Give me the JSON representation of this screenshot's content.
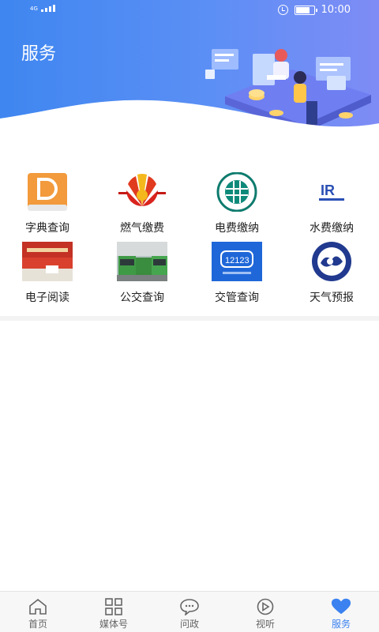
{
  "status_bar": {
    "network": "4G",
    "time": "10:00",
    "battery_level": 0.72
  },
  "header": {
    "title": "服务"
  },
  "services": [
    {
      "label": "字典查询",
      "icon": "dictionary-icon"
    },
    {
      "label": "燃气缴费",
      "icon": "petrochina-gas-icon"
    },
    {
      "label": "电费缴纳",
      "icon": "state-grid-icon"
    },
    {
      "label": "水费缴纳",
      "icon": "water-company-icon"
    },
    {
      "label": "电子阅读",
      "icon": "library-icon"
    },
    {
      "label": "公交查询",
      "icon": "bus-icon"
    },
    {
      "label": "交管查询",
      "icon": "traffic-12123-icon"
    },
    {
      "label": "天气预报",
      "icon": "weather-icon"
    }
  ],
  "service_icon_text": {
    "traffic": "12123",
    "water": "IR"
  },
  "bottom_nav": [
    {
      "label": "首页",
      "icon": "home-icon"
    },
    {
      "label": "媒体号",
      "icon": "grid-icon"
    },
    {
      "label": "问政",
      "icon": "chat-icon"
    },
    {
      "label": "视听",
      "icon": "play-icon"
    },
    {
      "label": "服务",
      "icon": "heart-icon",
      "active": true
    }
  ],
  "colors": {
    "accent": "#3b82f0",
    "header_start": "#3f86f0",
    "header_end": "#7f8cf5"
  }
}
